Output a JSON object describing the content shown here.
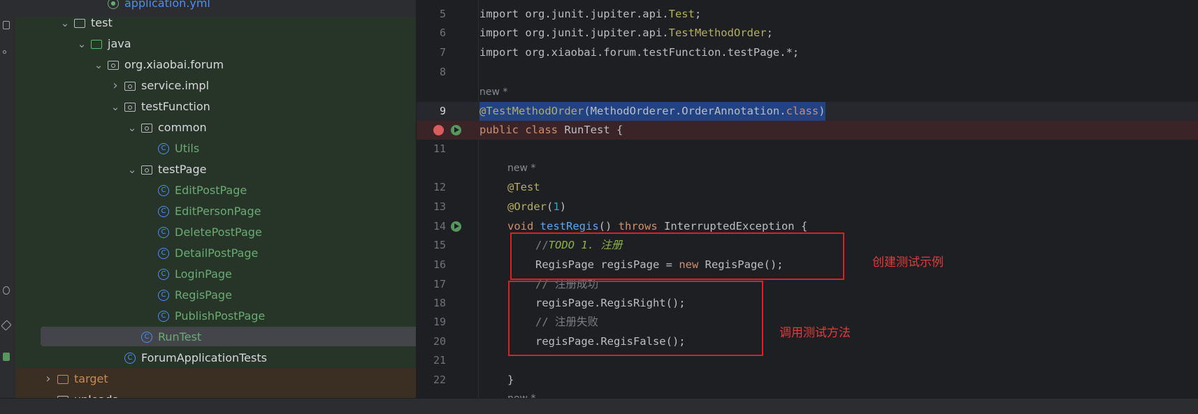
{
  "tree": {
    "items": [
      {
        "label": "application.yml",
        "indent": 5,
        "expanded": null,
        "icon": "yml-icon",
        "color": "#4d8ef5"
      },
      {
        "label": "test",
        "indent": 3,
        "expanded": true,
        "icon": "folder-icon",
        "color": "#d6d8dc"
      },
      {
        "label": "java",
        "indent": 4,
        "expanded": true,
        "icon": "green-folder-icon",
        "color": "#d6d8dc"
      },
      {
        "label": "org.xiaobai.forum",
        "indent": 5,
        "expanded": true,
        "icon": "package-icon",
        "color": "#d6d8dc"
      },
      {
        "label": "service.impl",
        "indent": 6,
        "expanded": false,
        "icon": "package-icon",
        "color": "#d6d8dc"
      },
      {
        "label": "testFunction",
        "indent": 6,
        "expanded": true,
        "icon": "package-icon",
        "color": "#d6d8dc"
      },
      {
        "label": "common",
        "indent": 7,
        "expanded": true,
        "icon": "package-icon",
        "color": "#d6d8dc"
      },
      {
        "label": "Utils",
        "indent": 8,
        "expanded": null,
        "icon": "class-icon",
        "color": "#6aab73"
      },
      {
        "label": "testPage",
        "indent": 7,
        "expanded": true,
        "icon": "package-icon",
        "color": "#d6d8dc"
      },
      {
        "label": "EditPostPage",
        "indent": 8,
        "expanded": null,
        "icon": "class-icon",
        "color": "#6aab73"
      },
      {
        "label": "EditPersonPage",
        "indent": 8,
        "expanded": null,
        "icon": "class-icon",
        "color": "#6aab73"
      },
      {
        "label": "DeletePostPage",
        "indent": 8,
        "expanded": null,
        "icon": "class-icon",
        "color": "#6aab73"
      },
      {
        "label": "DetailPostPage",
        "indent": 8,
        "expanded": null,
        "icon": "class-icon",
        "color": "#6aab73"
      },
      {
        "label": "LoginPage",
        "indent": 8,
        "expanded": null,
        "icon": "class-icon",
        "color": "#6aab73"
      },
      {
        "label": "RegisPage",
        "indent": 8,
        "expanded": null,
        "icon": "class-icon",
        "color": "#6aab73"
      },
      {
        "label": "PublishPostPage",
        "indent": 8,
        "expanded": null,
        "icon": "class-icon",
        "color": "#6aab73"
      },
      {
        "label": "RunTest",
        "indent": 7,
        "expanded": null,
        "icon": "class-icon",
        "color": "#6aab73",
        "selected": true
      },
      {
        "label": "ForumApplicationTests",
        "indent": 6,
        "expanded": null,
        "icon": "class-icon",
        "color": "#d6d8dc"
      },
      {
        "label": "target",
        "indent": 2,
        "expanded": false,
        "icon": "orange-folder-icon",
        "color": "#c98a4b"
      },
      {
        "label": "uploads",
        "indent": 2,
        "expanded": null,
        "icon": "folder-icon",
        "color": "#d6d8dc"
      }
    ]
  },
  "editor": {
    "lines": {
      "l5": {
        "num": "5",
        "t1": "import org.junit.jupiter.api.",
        "t2": "Test",
        "t3": ";"
      },
      "l6": {
        "num": "6",
        "t1": "import org.junit.jupiter.api.",
        "t2": "TestMethodOrder",
        "t3": ";"
      },
      "l7": {
        "num": "7",
        "t1": "import org.xiaobai.forum.testFunction.testPage.*;"
      },
      "l8": {
        "num": "8"
      },
      "hint1": "new *",
      "l9": {
        "num": "9",
        "t1": "@TestMethodOrder",
        "t2": "(MethodOrderer.OrderAnnotation.",
        "t3": "class",
        "t4": ")"
      },
      "l10": {
        "t1": "public class ",
        "t2": "RunTest {"
      },
      "l11": {
        "num": "11"
      },
      "hint2": "new *",
      "l12": {
        "num": "12",
        "t1": "@Test"
      },
      "l13": {
        "num": "13",
        "t1": "@Order",
        "t2": "(",
        "t3": "1",
        "t4": ")"
      },
      "l14": {
        "num": "14",
        "t1": "void ",
        "t2": "testRegis",
        "t3": "() ",
        "t4": "throws ",
        "t5": "InterruptedException {"
      },
      "l15": {
        "num": "15",
        "t1": "//",
        "t2": "TODO 1. 注册"
      },
      "l16": {
        "num": "16",
        "t1": "RegisPage regisPage = ",
        "t2": "new ",
        "t3": "RegisPage();"
      },
      "l17": {
        "num": "17",
        "t1": "// 注册成功"
      },
      "l18": {
        "num": "18",
        "t1": "regisPage.RegisRight();"
      },
      "l19": {
        "num": "19",
        "t1": "// 注册失败"
      },
      "l20": {
        "num": "20",
        "t1": "regisPage.RegisFalse();"
      },
      "l21": {
        "num": "21"
      },
      "l22": {
        "num": "22",
        "t1": "}"
      },
      "hint3": "new *"
    },
    "annotations": {
      "create_instance": "创建测试示例",
      "call_methods": "调用测试方法"
    }
  },
  "colors": {
    "annotation_red": "#e02020",
    "breakpoint": "#db5c5c",
    "run_gutter": "#57965c"
  }
}
